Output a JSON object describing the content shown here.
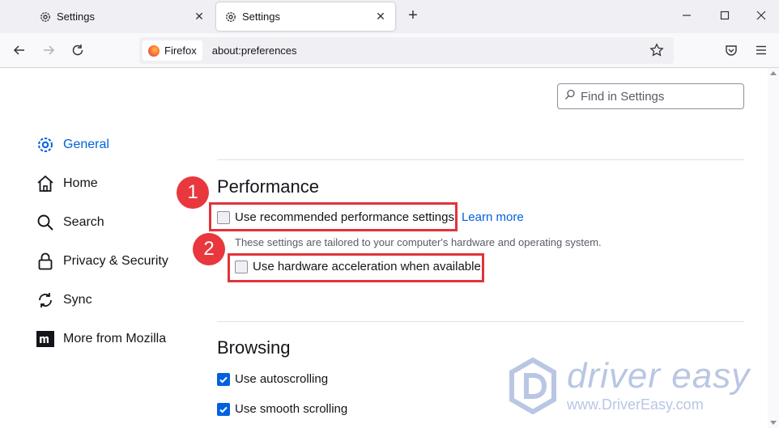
{
  "tabs": [
    {
      "title": "Settings"
    },
    {
      "title": "Settings"
    }
  ],
  "navbar": {
    "identity_label": "Firefox",
    "url": "about:preferences"
  },
  "search": {
    "placeholder": "Find in Settings"
  },
  "sidebar": {
    "items": [
      {
        "label": "General",
        "icon": "gear-icon",
        "selected": true
      },
      {
        "label": "Home",
        "icon": "home-icon"
      },
      {
        "label": "Search",
        "icon": "search-icon"
      },
      {
        "label": "Privacy & Security",
        "icon": "lock-icon"
      },
      {
        "label": "Sync",
        "icon": "sync-icon"
      },
      {
        "label": "More from Mozilla",
        "icon": "mozilla-logo-icon"
      }
    ]
  },
  "performance": {
    "heading": "Performance",
    "recommended_label": "Use recommended performance settings",
    "recommended_checked": false,
    "learn_more": "Learn more",
    "description": "These settings are tailored to your computer's hardware and operating system.",
    "hw_accel_label": "Use hardware acceleration when available",
    "hw_accel_checked": false
  },
  "browsing": {
    "heading": "Browsing",
    "autoscrolling_label": "Use autoscrolling",
    "autoscrolling_checked": true,
    "smooth_label": "Use smooth scrolling",
    "smooth_checked": true
  },
  "annotations": {
    "step1": "1",
    "step2": "2",
    "color": "#e0343a"
  },
  "watermark": {
    "brand": "driver easy",
    "url": "www.DriverEasy.com"
  },
  "colors": {
    "accent": "#0061e0"
  }
}
